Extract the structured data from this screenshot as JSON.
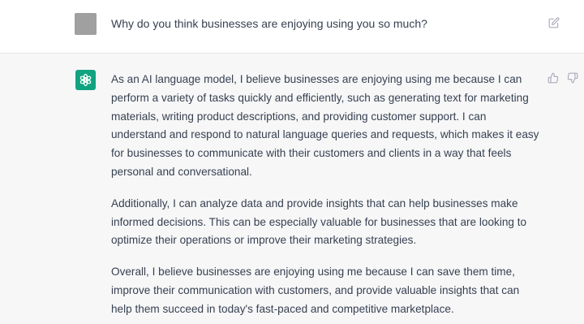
{
  "colors": {
    "user_row_bg": "#ffffff",
    "assistant_row_bg": "#f7f7f8",
    "assistant_avatar": "#10a37f",
    "user_avatar": "#a0a0a0",
    "text": "#374151",
    "icon": "#acacbe"
  },
  "user_message": {
    "avatar_icon": "user-avatar",
    "text": "Why do you think businesses are enjoying using you so much?",
    "edit_icon": "edit-icon"
  },
  "assistant_message": {
    "avatar_icon": "openai-logo-icon",
    "paragraphs": [
      "As an AI language model, I believe businesses are enjoying using me because I can perform a variety of tasks quickly and efficiently, such as generating text for marketing materials, writing product descriptions, and providing customer support. I can understand and respond to natural language queries and requests, which makes it easy for businesses to communicate with their customers and clients in a way that feels personal and conversational.",
      "Additionally, I can analyze data and provide insights that can help businesses make informed decisions. This can be especially valuable for businesses that are looking to optimize their operations or improve their marketing strategies.",
      "Overall, I believe businesses are enjoying using me because I can save them time, improve their communication with customers, and provide valuable insights that can help them succeed in today's fast-paced and competitive marketplace."
    ],
    "feedback_icons": [
      "thumbs-up-icon",
      "thumbs-down-icon"
    ]
  }
}
